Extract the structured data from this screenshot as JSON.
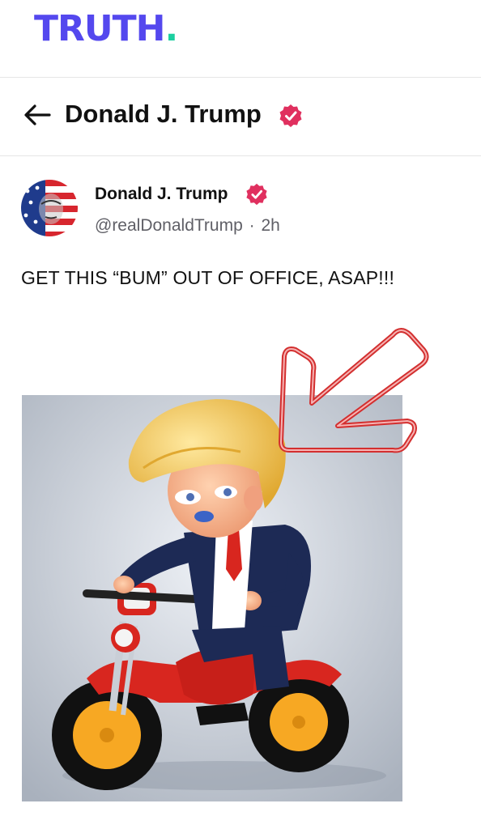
{
  "app": {
    "logo_text": "TRUTH",
    "logo_dot": ".",
    "brand_color": "#5448ee",
    "dot_color": "#1ccfa0"
  },
  "profile_header": {
    "name": "Donald J. Trump",
    "back_icon": "arrow-left-icon",
    "verified_icon": "verified-badge-icon"
  },
  "post": {
    "author_name": "Donald J. Trump",
    "handle": "@realDonaldTrump",
    "separator": "·",
    "timestamp": "2h",
    "text": "GET THIS “BUM” OUT OF OFFICE, ASAP!!!",
    "media": "cartoon-man-riding-red-tricycle-image",
    "annotation": "red-outlined-arrow-icon"
  },
  "colors": {
    "verified": "#e0305f",
    "handle_gray": "#5f5f66",
    "divider": "#e5e5e5",
    "arrow_red": "#d32f2f"
  }
}
